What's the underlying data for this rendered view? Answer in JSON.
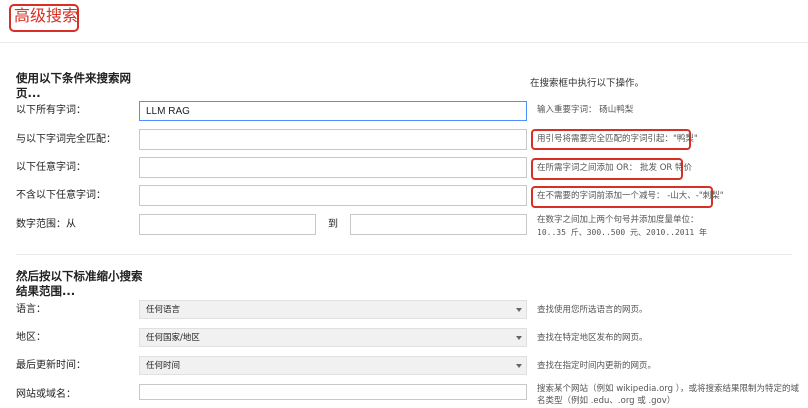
{
  "page": {
    "title": "高级搜索"
  },
  "section1": {
    "heading": "使用以下条件来搜索网页...",
    "right_heading": "在搜索框中执行以下操作。",
    "rows": [
      {
        "label": "以下所有字词：",
        "value": "LLM RAG",
        "hint": "输入重要字词：   砀山鸭梨"
      },
      {
        "label": "与以下字词完全匹配：",
        "value": "",
        "hint": "用引号将需要完全匹配的字词引起：\"鸭梨\""
      },
      {
        "label": "以下任意字词：",
        "value": "",
        "hint": "在所需字词之间添加 OR： 批发 OR 特价"
      },
      {
        "label": "不含以下任意字词：",
        "value": "",
        "hint": "在不需要的字词前添加一个减号： -山大、-\"刺梨\""
      }
    ],
    "range": {
      "label": "数字范围：从",
      "to_label": "到",
      "hint_line1": "在数字之间加上两个句号并添加度量单位：",
      "hint_line2": "10..35 斤、300..500 元、2010..2011 年"
    }
  },
  "section2": {
    "heading": "然后按以下标准缩小搜索结果范围...",
    "rows": [
      {
        "label": "语言：",
        "value": "任何语言",
        "hint": "查找使用您所选语言的网页。"
      },
      {
        "label": "地区：",
        "value": "任何国家/地区",
        "hint": "查找在特定地区发布的网页。"
      },
      {
        "label": "最后更新时间：",
        "value": "任何时间",
        "hint": "查找在指定时间内更新的网页。"
      }
    ],
    "site": {
      "label": "网站或域名：",
      "hint_line1": "搜索某个网站（例如 wikipedia.org ），或将搜索结果限制为特定的域",
      "hint_line2": "名类型（例如 .edu、.org 或 .gov）"
    }
  },
  "colors": {
    "accent_red": "#d93025",
    "focus_blue": "#4d90fe"
  }
}
